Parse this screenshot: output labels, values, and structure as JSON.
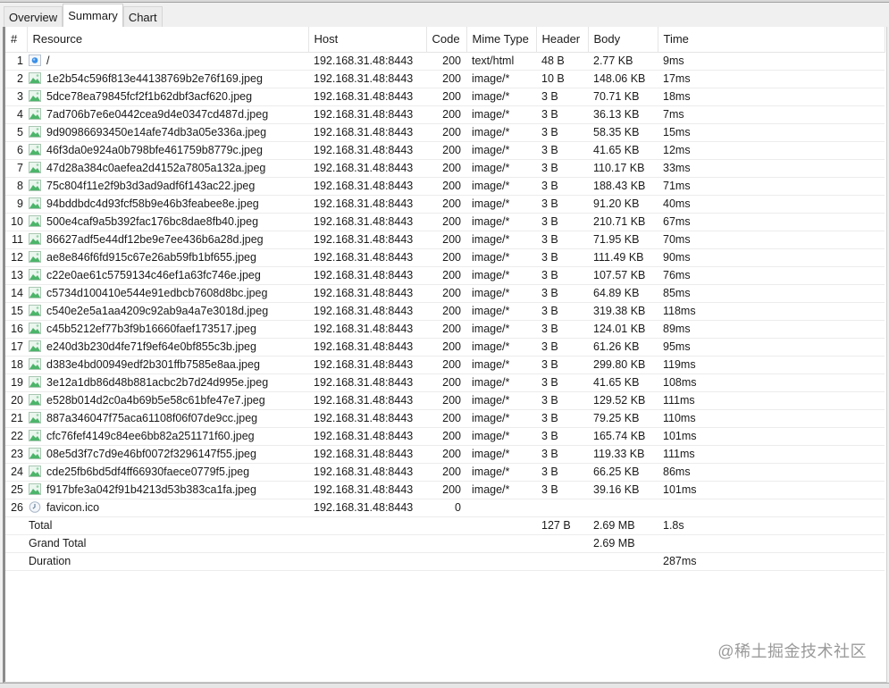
{
  "tabs": [
    {
      "label": "Overview",
      "active": false
    },
    {
      "label": "Summary",
      "active": true
    },
    {
      "label": "Chart",
      "active": false
    }
  ],
  "columns": [
    "#",
    "Resource",
    "Host",
    "Code",
    "Mime Type",
    "Header",
    "Body",
    "Time"
  ],
  "rows": [
    {
      "n": "1",
      "icon": "html-page-icon",
      "resource": "/",
      "host": "192.168.31.48:8443",
      "code": "200",
      "mime": "text/html",
      "header": "48 B",
      "body": "2.77 KB",
      "time": "9ms"
    },
    {
      "n": "2",
      "icon": "image-file-icon",
      "resource": "1e2b54c596f813e44138769b2e76f169.jpeg",
      "host": "192.168.31.48:8443",
      "code": "200",
      "mime": "image/*",
      "header": "10 B",
      "body": "148.06 KB",
      "time": "17ms"
    },
    {
      "n": "3",
      "icon": "image-file-icon",
      "resource": "5dce78ea79845fcf2f1b62dbf3acf620.jpeg",
      "host": "192.168.31.48:8443",
      "code": "200",
      "mime": "image/*",
      "header": "3 B",
      "body": "70.71 KB",
      "time": "18ms"
    },
    {
      "n": "4",
      "icon": "image-file-icon",
      "resource": "7ad706b7e6e0442cea9d4e0347cd487d.jpeg",
      "host": "192.168.31.48:8443",
      "code": "200",
      "mime": "image/*",
      "header": "3 B",
      "body": "36.13 KB",
      "time": "7ms"
    },
    {
      "n": "5",
      "icon": "image-file-icon",
      "resource": "9d90986693450e14afe74db3a05e336a.jpeg",
      "host": "192.168.31.48:8443",
      "code": "200",
      "mime": "image/*",
      "header": "3 B",
      "body": "58.35 KB",
      "time": "15ms"
    },
    {
      "n": "6",
      "icon": "image-file-icon",
      "resource": "46f3da0e924a0b798bfe461759b8779c.jpeg",
      "host": "192.168.31.48:8443",
      "code": "200",
      "mime": "image/*",
      "header": "3 B",
      "body": "41.65 KB",
      "time": "12ms"
    },
    {
      "n": "7",
      "icon": "image-file-icon",
      "resource": "47d28a384c0aefea2d4152a7805a132a.jpeg",
      "host": "192.168.31.48:8443",
      "code": "200",
      "mime": "image/*",
      "header": "3 B",
      "body": "110.17 KB",
      "time": "33ms"
    },
    {
      "n": "8",
      "icon": "image-file-icon",
      "resource": "75c804f11e2f9b3d3ad9adf6f143ac22.jpeg",
      "host": "192.168.31.48:8443",
      "code": "200",
      "mime": "image/*",
      "header": "3 B",
      "body": "188.43 KB",
      "time": "71ms"
    },
    {
      "n": "9",
      "icon": "image-file-icon",
      "resource": "94bddbdc4d93fcf58b9e46b3feabee8e.jpeg",
      "host": "192.168.31.48:8443",
      "code": "200",
      "mime": "image/*",
      "header": "3 B",
      "body": "91.20 KB",
      "time": "40ms"
    },
    {
      "n": "10",
      "icon": "image-file-icon",
      "resource": "500e4caf9a5b392fac176bc8dae8fb40.jpeg",
      "host": "192.168.31.48:8443",
      "code": "200",
      "mime": "image/*",
      "header": "3 B",
      "body": "210.71 KB",
      "time": "67ms"
    },
    {
      "n": "11",
      "icon": "image-file-icon",
      "resource": "86627adf5e44df12be9e7ee436b6a28d.jpeg",
      "host": "192.168.31.48:8443",
      "code": "200",
      "mime": "image/*",
      "header": "3 B",
      "body": "71.95 KB",
      "time": "70ms"
    },
    {
      "n": "12",
      "icon": "image-file-icon",
      "resource": "ae8e846f6fd915c67e26ab59fb1bf655.jpeg",
      "host": "192.168.31.48:8443",
      "code": "200",
      "mime": "image/*",
      "header": "3 B",
      "body": "111.49 KB",
      "time": "90ms"
    },
    {
      "n": "13",
      "icon": "image-file-icon",
      "resource": "c22e0ae61c5759134c46ef1a63fc746e.jpeg",
      "host": "192.168.31.48:8443",
      "code": "200",
      "mime": "image/*",
      "header": "3 B",
      "body": "107.57 KB",
      "time": "76ms"
    },
    {
      "n": "14",
      "icon": "image-file-icon",
      "resource": "c5734d100410e544e91edbcb7608d8bc.jpeg",
      "host": "192.168.31.48:8443",
      "code": "200",
      "mime": "image/*",
      "header": "3 B",
      "body": "64.89 KB",
      "time": "85ms"
    },
    {
      "n": "15",
      "icon": "image-file-icon",
      "resource": "c540e2e5a1aa4209c92ab9a4a7e3018d.jpeg",
      "host": "192.168.31.48:8443",
      "code": "200",
      "mime": "image/*",
      "header": "3 B",
      "body": "319.38 KB",
      "time": "118ms"
    },
    {
      "n": "16",
      "icon": "image-file-icon",
      "resource": "c45b5212ef77b3f9b16660faef173517.jpeg",
      "host": "192.168.31.48:8443",
      "code": "200",
      "mime": "image/*",
      "header": "3 B",
      "body": "124.01 KB",
      "time": "89ms"
    },
    {
      "n": "17",
      "icon": "image-file-icon",
      "resource": "e240d3b230d4fe71f9ef64e0bf855c3b.jpeg",
      "host": "192.168.31.48:8443",
      "code": "200",
      "mime": "image/*",
      "header": "3 B",
      "body": "61.26 KB",
      "time": "95ms"
    },
    {
      "n": "18",
      "icon": "image-file-icon",
      "resource": "d383e4bd00949edf2b301ffb7585e8aa.jpeg",
      "host": "192.168.31.48:8443",
      "code": "200",
      "mime": "image/*",
      "header": "3 B",
      "body": "299.80 KB",
      "time": "119ms"
    },
    {
      "n": "19",
      "icon": "image-file-icon",
      "resource": "3e12a1db86d48b881acbc2b7d24d995e.jpeg",
      "host": "192.168.31.48:8443",
      "code": "200",
      "mime": "image/*",
      "header": "3 B",
      "body": "41.65 KB",
      "time": "108ms"
    },
    {
      "n": "20",
      "icon": "image-file-icon",
      "resource": "e528b014d2c0a4b69b5e58c61bfe47e7.jpeg",
      "host": "192.168.31.48:8443",
      "code": "200",
      "mime": "image/*",
      "header": "3 B",
      "body": "129.52 KB",
      "time": "111ms"
    },
    {
      "n": "21",
      "icon": "image-file-icon",
      "resource": "887a346047f75aca61108f06f07de9cc.jpeg",
      "host": "192.168.31.48:8443",
      "code": "200",
      "mime": "image/*",
      "header": "3 B",
      "body": "79.25 KB",
      "time": "110ms"
    },
    {
      "n": "22",
      "icon": "image-file-icon",
      "resource": "cfc76fef4149c84ee6bb82a251171f60.jpeg",
      "host": "192.168.31.48:8443",
      "code": "200",
      "mime": "image/*",
      "header": "3 B",
      "body": "165.74 KB",
      "time": "101ms"
    },
    {
      "n": "23",
      "icon": "image-file-icon",
      "resource": "08e5d3f7c7d9e46bf0072f3296147f55.jpeg",
      "host": "192.168.31.48:8443",
      "code": "200",
      "mime": "image/*",
      "header": "3 B",
      "body": "119.33 KB",
      "time": "111ms"
    },
    {
      "n": "24",
      "icon": "image-file-icon",
      "resource": "cde25fb6bd5df4ff66930faece0779f5.jpeg",
      "host": "192.168.31.48:8443",
      "code": "200",
      "mime": "image/*",
      "header": "3 B",
      "body": "66.25 KB",
      "time": "86ms"
    },
    {
      "n": "25",
      "icon": "image-file-icon",
      "resource": "f917bfe3a042f91b4213d53b383ca1fa.jpeg",
      "host": "192.168.31.48:8443",
      "code": "200",
      "mime": "image/*",
      "header": "3 B",
      "body": "39.16 KB",
      "time": "101ms"
    },
    {
      "n": "26",
      "icon": "pending-clock-icon",
      "resource": "favicon.ico",
      "host": "192.168.31.48:8443",
      "code": "0",
      "mime": "",
      "header": "",
      "body": "",
      "time": ""
    }
  ],
  "summary": [
    {
      "label": "Total",
      "header": "127 B",
      "body": "2.69 MB",
      "time": "1.8s"
    },
    {
      "label": "Grand Total",
      "header": "",
      "body": "2.69 MB",
      "time": ""
    },
    {
      "label": "Duration",
      "header": "",
      "body": "",
      "time": "287ms"
    }
  ],
  "watermark": "@稀土掘金技术社区"
}
